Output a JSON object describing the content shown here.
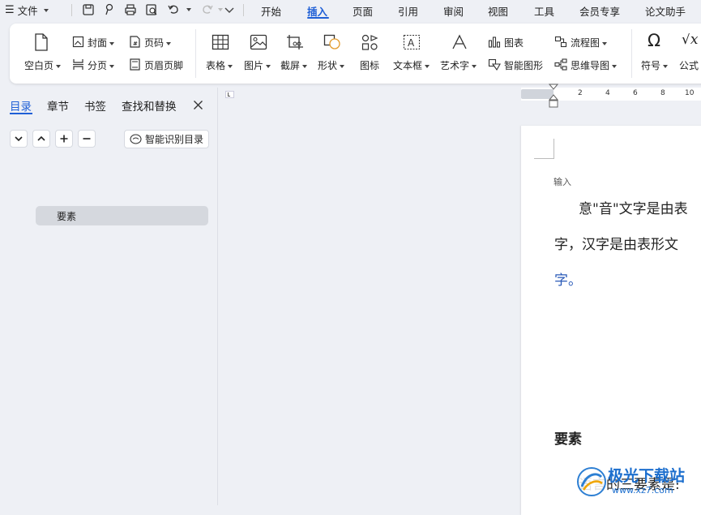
{
  "menubar": {
    "file_label": "文件",
    "tabs": [
      "开始",
      "插入",
      "页面",
      "引用",
      "审阅",
      "视图",
      "工具",
      "会员专享",
      "论文助手"
    ],
    "active_tab": "插入"
  },
  "ribbon": {
    "blank_page": "空白页",
    "cover": "封面",
    "page_break": "分页",
    "page_number": "页码",
    "header_footer": "页眉页脚",
    "table": "表格",
    "picture": "图片",
    "screenshot": "截屏",
    "shape": "形状",
    "icon": "图标",
    "textbox": "文本框",
    "wordart": "艺术字",
    "chart": "图表",
    "smart_graphic": "智能图形",
    "flowchart": "流程图",
    "mindmap": "思维导图",
    "symbol": "符号",
    "formula": "公式"
  },
  "sidebar": {
    "tabs": [
      "目录",
      "章节",
      "书签",
      "查找和替换"
    ],
    "active_tab": "目录",
    "smart_toc_label": "智能识别目录",
    "toc_items": [
      "要素"
    ]
  },
  "ruler": {
    "ticks": [
      "2",
      "4",
      "6",
      "8",
      "10"
    ]
  },
  "document": {
    "hint": "输入",
    "para1_line1": "意\"音\"文字是由表",
    "para1_line2": "字，汉字是由表形文",
    "para1_line3": "字。",
    "heading": "要素",
    "para2_line1": "语言的三要素是:"
  },
  "watermark": {
    "text_top": "极光下载站",
    "text_bottom": "www.xz7.com"
  },
  "colors": {
    "accent": "#1f5fd6",
    "link_text": "#2a5ab8"
  }
}
